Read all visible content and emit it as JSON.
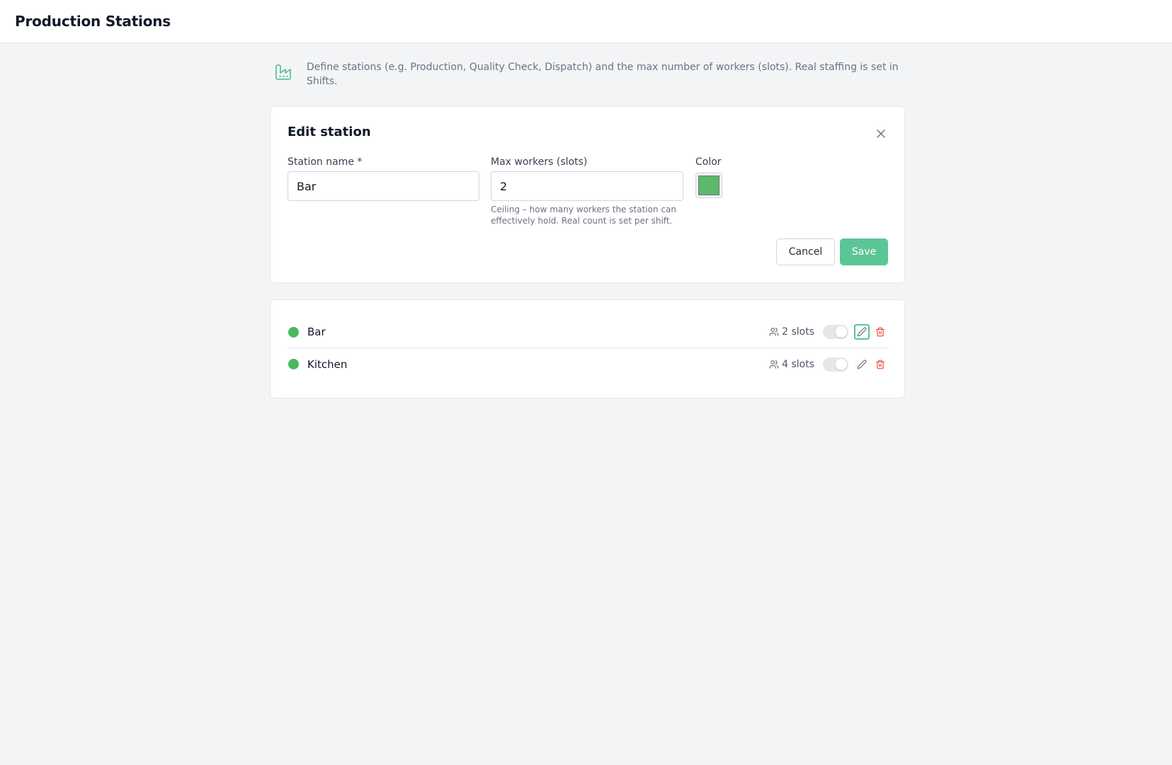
{
  "header": {
    "title": "Production Stations"
  },
  "info": {
    "icon": "factory-icon",
    "text": "Define stations (e.g. Production, Quality Check, Dispatch) and the max number of workers (slots). Real staffing is set in Shifts."
  },
  "edit_form": {
    "title": "Edit station",
    "name_label": "Station name *",
    "name_value": "Bar",
    "max_workers_label": "Max workers (slots)",
    "max_workers_value": "2",
    "max_workers_helper": "Ceiling – how many workers the station can effectively hold. Real count is set per shift.",
    "color_label": "Color",
    "color_value": "#5cb96a",
    "cancel_label": "Cancel",
    "save_label": "Save"
  },
  "stations": [
    {
      "name": "Bar",
      "slots_text": "2 slots",
      "color": "#4cb85c",
      "active": false
    },
    {
      "name": "Kitchen",
      "slots_text": "4 slots",
      "color": "#4cb85c",
      "active": false
    }
  ],
  "colors": {
    "accent": "#5cc596",
    "danger": "#ef4444",
    "muted": "#9ca3af"
  }
}
